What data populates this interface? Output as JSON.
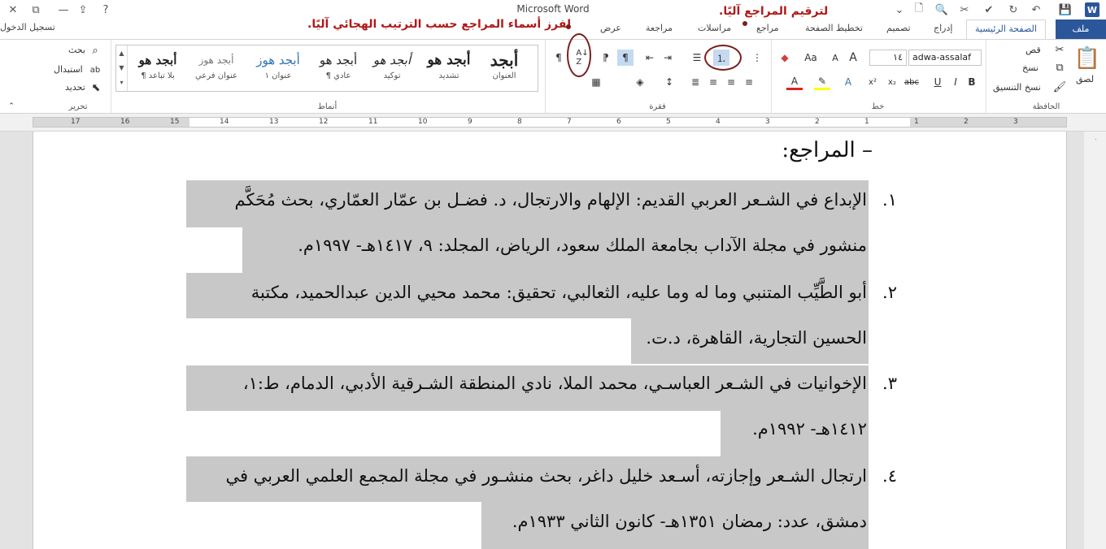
{
  "app": {
    "title": "Microsoft Word",
    "sign_in": "تسجيل الدخول"
  },
  "tabs": [
    {
      "label": "ملف"
    },
    {
      "label": "الصفحة الرئيسية"
    },
    {
      "label": "إدراج"
    },
    {
      "label": "تصميم"
    },
    {
      "label": "تخطيط الصفحة"
    },
    {
      "label": "مراجع"
    },
    {
      "label": "مراسلات"
    },
    {
      "label": "مراجعة"
    },
    {
      "label": "عرض"
    }
  ],
  "ribbon": {
    "clipboard": {
      "label": "الحافظة",
      "paste": "لصق",
      "cut": "قص",
      "copy": "نسخ",
      "format_painter": "نسخ التنسيق"
    },
    "font": {
      "label": "خط",
      "font_name": "adwa-assalaf",
      "font_size": "١٤"
    },
    "paragraph": {
      "label": "فقرة"
    },
    "styles": {
      "label": "أنماط",
      "items": [
        {
          "sample": "أبجد",
          "name": "العنوان"
        },
        {
          "sample": "أبجد هو",
          "name": "تشديد"
        },
        {
          "sample": "أبجد هو",
          "name": "توكيد"
        },
        {
          "sample": "أبجد هو",
          "name": "¶ عادي"
        },
        {
          "sample": "أبجد هوز",
          "name": "عنوان ١"
        },
        {
          "sample": "أبجد هوز",
          "name": "عنوان فرعي"
        },
        {
          "sample": "أبجد هو",
          "name": "¶ بلا تباعد"
        }
      ]
    },
    "editing": {
      "label": "تحرير",
      "find": "بحث",
      "replace": "استبدال",
      "select": "تحديد"
    }
  },
  "annotations": {
    "sort": "لفرز أسماء المراجع حسب الترتيب الهجائي آليًا.",
    "numbering": "لترقيم المراجع آليًا."
  },
  "ruler": {
    "numbers": [
      "17",
      "16",
      "15",
      "14",
      "13",
      "12",
      "11",
      "10",
      "9",
      "8",
      "7",
      "6",
      "5",
      "4",
      "3",
      "2",
      "1",
      "1",
      "2",
      "3"
    ]
  },
  "document": {
    "heading": "– المراجع:",
    "references": [
      {
        "num": "١.",
        "line1": "الإبداع في الشـعر العربي القديم: الإلهام والارتجال، د. فضـل بن عمّار العمّاري، بحث مُحَكَّم",
        "line2": "منشور في مجلة الآداب بجامعة الملك سعود، الرياض، المجلد: ٩، ١٤١٧هـ- ١٩٩٧م."
      },
      {
        "num": "٢.",
        "line1": "أبو الطَّيِّب المتنبي وما له وما عليه، الثعالبي، تحقيق: محمد محيي الدين عبدالحميد، مكتبة",
        "line2": "الحسين التجارية، القاهرة، د.ت."
      },
      {
        "num": "٣.",
        "line1": "الإخوانيات في الشـعر العباسـي، محمد الملا، نادي المنطقة الشـرقية الأدبي، الدمام، ط:١،",
        "line2": "١٤١٢هـ- ١٩٩٢م."
      },
      {
        "num": "٤.",
        "line1": "ارتجال الشـعر وإجازته، أسـعد خليل داغر، بحث منشـور في مجلة المجمع العلمي العربي في",
        "line2": "دمشق، عدد: رمضان ١٣٥١هـ- كانون الثاني ١٩٣٣م."
      }
    ]
  }
}
